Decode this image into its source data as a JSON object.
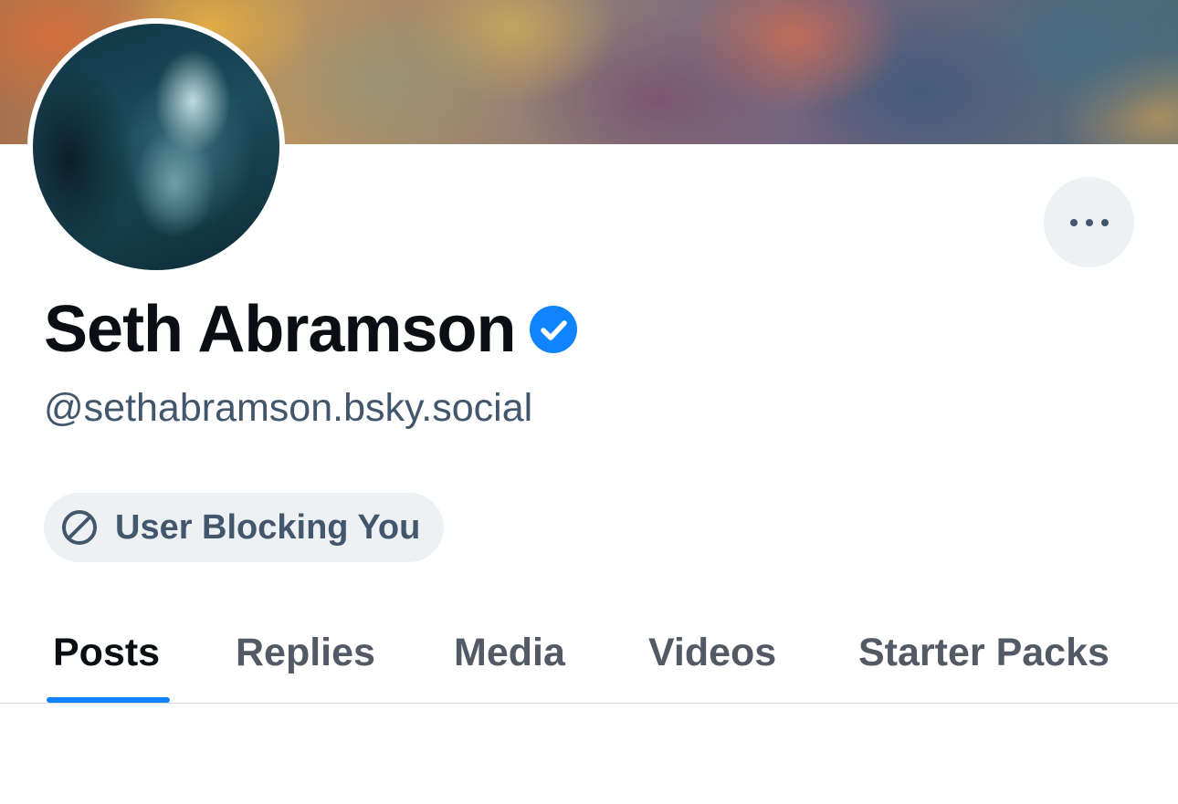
{
  "profile": {
    "display_name": "Seth Abramson",
    "handle": "@sethabramson.bsky.social",
    "verified": true,
    "block_status": "User Blocking You"
  },
  "tabs": [
    {
      "label": "Posts",
      "active": true
    },
    {
      "label": "Replies",
      "active": false
    },
    {
      "label": "Media",
      "active": false
    },
    {
      "label": "Videos",
      "active": false
    },
    {
      "label": "Starter Packs",
      "active": false
    }
  ],
  "icons": {
    "more": "more-horizontal-icon",
    "verified": "verified-check-icon",
    "block": "block-icon"
  },
  "colors": {
    "accent": "#1083fe",
    "text_primary": "#0b0f14",
    "text_secondary": "#42576c",
    "pill_bg": "#eef1f4"
  }
}
